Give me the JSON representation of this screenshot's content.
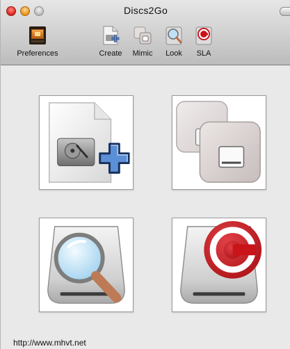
{
  "window": {
    "title": "Discs2Go"
  },
  "toolbar": {
    "items": [
      {
        "label": "Preferences",
        "icon": "preferences-icon"
      },
      {
        "label": "Create",
        "icon": "create-disc-icon"
      },
      {
        "label": "Mimic",
        "icon": "mimic-disc-icon"
      },
      {
        "label": "Look",
        "icon": "look-magnifier-icon"
      },
      {
        "label": "SLA",
        "icon": "sla-copyright-icon"
      }
    ]
  },
  "tiles": [
    {
      "icon": "create-disc-plus-icon"
    },
    {
      "icon": "mimic-stacked-drives-icon"
    },
    {
      "icon": "look-drive-magnifier-icon"
    },
    {
      "icon": "sla-drive-copyright-icon"
    }
  ],
  "status": {
    "url": "http://www.mhvt.net"
  },
  "colors": {
    "titlebar_top": "#e6e6e6",
    "titlebar_bottom": "#bcbcbc",
    "window_background": "#e9e9e9",
    "close_red": "#d9241b",
    "minimize_orange": "#e58f14",
    "plus_blue": "#5b8fd6",
    "sla_red": "#c9141a"
  }
}
